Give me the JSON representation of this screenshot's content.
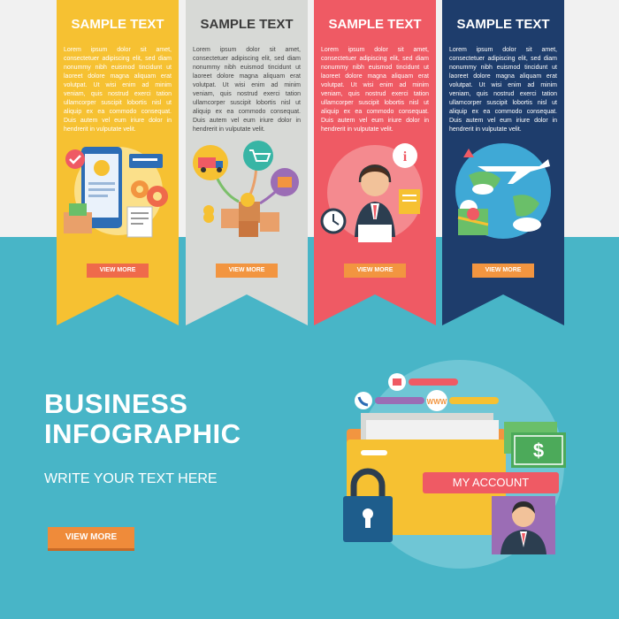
{
  "banners": [
    {
      "title": "SAMPLE TEXT",
      "body": "Lorem ipsum dolor sit amet, consectetuer adipiscing elit, sed diam nonummy nibh euismod tincidunt ut laoreet dolore magna aliquam erat volutpat. Ut wisi enim ad minim veniam, quis nostrud exerci tation ullamcorper suscipit lobortis nisl ut aliquip ex ea commodo consequat. Duis autem vel eum iriure dolor in hendrerit in vulputate velit.",
      "button": "VIEW MORE",
      "icon": "mobile-app-icon"
    },
    {
      "title": "SAMPLE TEXT",
      "body": "Lorem ipsum dolor sit amet, consectetuer adipiscing elit, sed diam nonummy nibh euismod tincidunt ut laoreet dolore magna aliquam erat volutpat. Ut wisi enim ad minim veniam, quis nostrud exerci tation ullamcorper suscipit lobortis nisl ut aliquip ex ea commodo consequat. Duis autem vel eum iriure dolor in hendrerit in vulputate velit.",
      "button": "VIEW MORE",
      "icon": "delivery-icon"
    },
    {
      "title": "SAMPLE TEXT",
      "body": "Lorem ipsum dolor sit amet, consectetuer adipiscing elit, sed diam nonummy nibh euismod tincidunt ut laoreet dolore magna aliquam erat volutpat. Ut wisi enim ad minim veniam, quis nostrud exerci tation ullamcorper suscipit lobortis nisl ut aliquip ex ea commodo consequat. Duis autem vel eum iriure dolor in hendrerit in vulputate velit.",
      "button": "VIEW MORE",
      "icon": "support-agent-icon"
    },
    {
      "title": "SAMPLE TEXT",
      "body": "Lorem ipsum dolor sit amet, consectetuer adipiscing elit, sed diam nonummy nibh euismod tincidunt ut laoreet dolore magna aliquam erat volutpat. Ut wisi enim ad minim veniam, quis nostrud exerci tation ullamcorper suscipit lobortis nisl ut aliquip ex ea commodo consequat. Duis autem vel eum iriure dolor in hendrerit in vulputate velit.",
      "button": "VIEW MORE",
      "icon": "travel-globe-icon"
    }
  ],
  "hero": {
    "title_line1": "BUSINESS",
    "title_line2": "INFOGRAPHIC",
    "subtitle": "WRITE YOUR TEXT HERE",
    "button": "VIEW MORE"
  },
  "illustration": {
    "account_label": "MY ACCOUNT",
    "web_label": "WWW",
    "money_symbol": "$",
    "icon": "account-folder-icon"
  },
  "colors": {
    "yellow": "#f6c132",
    "grey": "#d7d9d6",
    "red": "#ef5a64",
    "navy": "#1e3d6c",
    "teal": "#48b5c7",
    "orange": "#f29540"
  }
}
